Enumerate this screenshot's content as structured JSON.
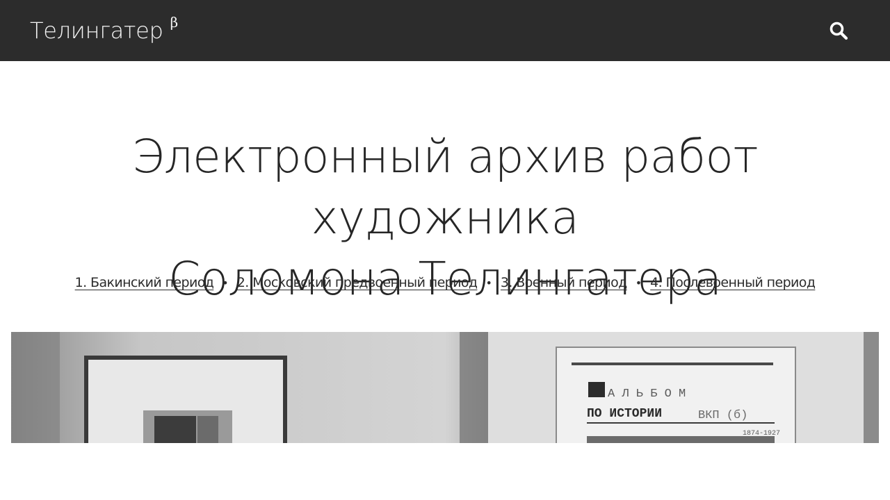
{
  "header": {
    "logo_text": "Телингатер",
    "logo_beta": "β",
    "search_icon": "search-icon"
  },
  "main": {
    "title_line1": "Электронный архив работ художника",
    "title_line2": "Соломона Телингатера",
    "nav": [
      {
        "label": "1. Бакинский период"
      },
      {
        "label": "2. Московский предвоенный период"
      },
      {
        "label": "3. Военный период"
      },
      {
        "label": "4. Послевоенный период"
      }
    ],
    "nav_separator": "•",
    "photo": {
      "poster_line1": "А Л Ь Б О М",
      "poster_line2": "ПО ИСТОРИИ",
      "poster_line3": "ВКП (б)",
      "poster_line4": "1874-1927"
    }
  },
  "colors": {
    "topbar": "#2c2c2c",
    "text": "#262626"
  }
}
